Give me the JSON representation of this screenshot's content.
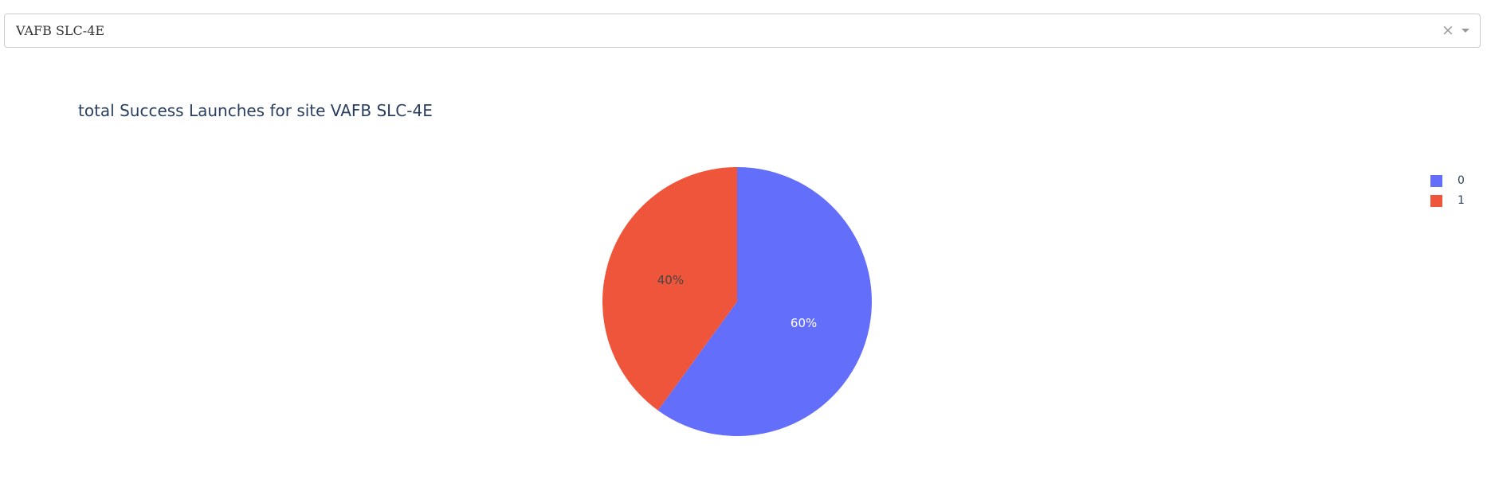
{
  "dropdown": {
    "selected_value": "VAFB SLC-4E",
    "clear_glyph": "×",
    "clear_icon": "close-icon",
    "arrow_icon": "chevron-down-icon"
  },
  "chart_data": {
    "type": "pie",
    "title": "total Success Launches for site VAFB SLC-4E",
    "labels": [
      "0",
      "1"
    ],
    "values": [
      60,
      40
    ],
    "percent_labels": [
      "60%",
      "40%"
    ],
    "colors": [
      "#636efa",
      "#ef553b"
    ],
    "text_colors": [
      "#ffffff",
      "#444444"
    ],
    "direction": "clockwise",
    "start_angle_deg": 90,
    "legend_position": "top-right"
  }
}
